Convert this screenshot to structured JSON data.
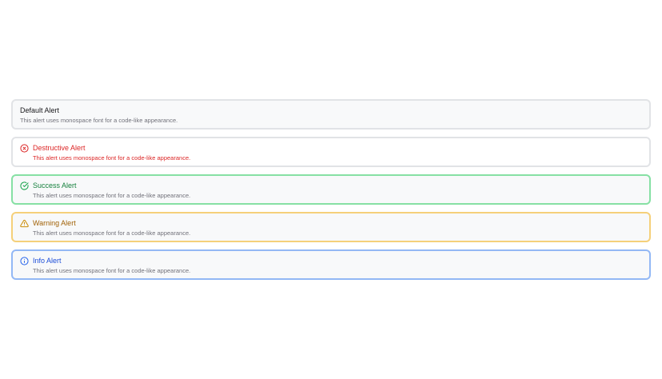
{
  "alerts": {
    "default": {
      "title": "Default Alert",
      "description": "This alert uses monospace font for a code-like appearance."
    },
    "destructive": {
      "title": "Destructive Alert",
      "description": "This alert uses monospace font for a code-like appearance.",
      "icon": "x-circle-icon",
      "color": "#dc2626"
    },
    "success": {
      "title": "Success Alert",
      "description": "This alert uses monospace font for a code-like appearance.",
      "icon": "check-circle-icon",
      "color": "#16a34a"
    },
    "warning": {
      "title": "Warning Alert",
      "description": "This alert uses monospace font for a code-like appearance.",
      "icon": "warning-triangle-icon",
      "color": "#ca8a04"
    },
    "info": {
      "title": "Info Alert",
      "description": "This alert uses monospace font for a code-like appearance.",
      "icon": "info-circle-icon",
      "color": "#2563eb"
    }
  }
}
